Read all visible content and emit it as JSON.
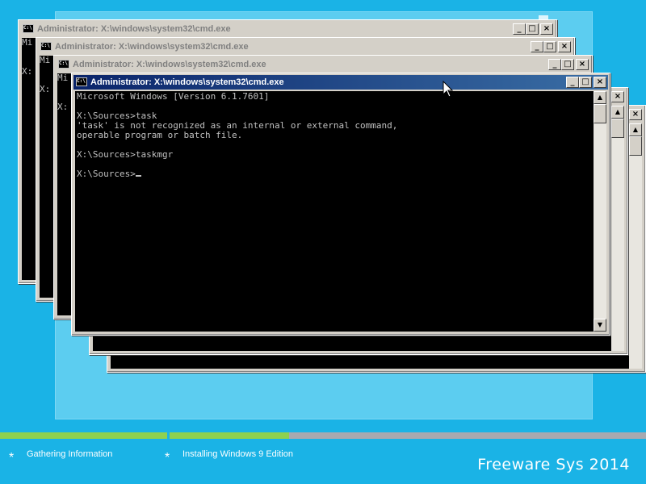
{
  "setup": {
    "progress": [
      {
        "fill_percent": 100
      },
      {
        "fill_percent": 25
      }
    ],
    "steps": [
      {
        "label": "Gathering Information"
      },
      {
        "label": "Installing Windows 9 Edition"
      }
    ],
    "brand": "Freeware Sys 2014"
  },
  "windows": {
    "title": "Administrator: X:\\windows\\system32\\cmd.exe",
    "controls": {
      "minimize": "_",
      "maximize": "□",
      "close": "×"
    },
    "background_line_1": "Mi",
    "background_line_2": "X:",
    "active": {
      "lines": [
        "Microsoft Windows [Version 6.1.7601]",
        "",
        "X:\\Sources>task",
        "'task' is not recognized as an internal or external command,",
        "operable program or batch file.",
        "",
        "X:\\Sources>taskmgr",
        "",
        "X:\\Sources>"
      ]
    }
  },
  "colors": {
    "desktop": "#1ab3e6",
    "title_active": "#0a246a",
    "progress_green": "#8fd14f"
  }
}
